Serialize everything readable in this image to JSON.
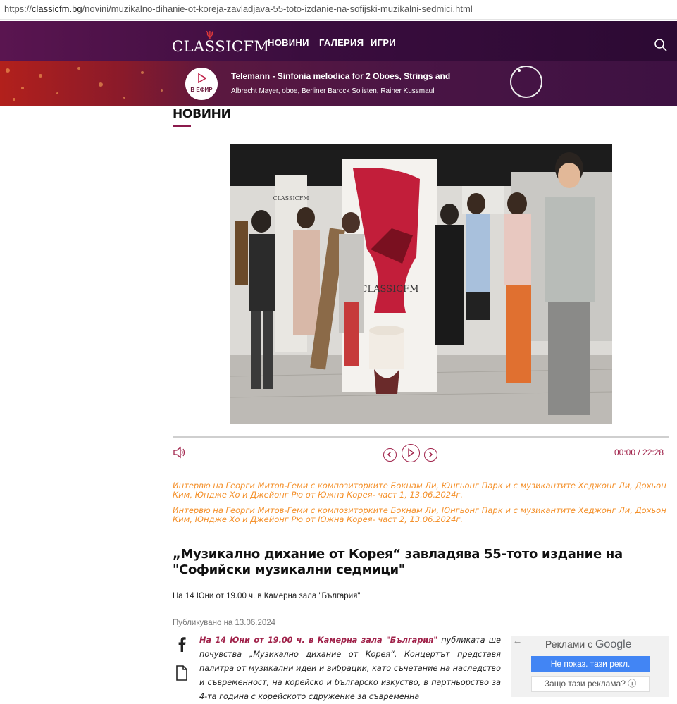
{
  "browser": {
    "url_scheme": "https://",
    "url_host": "classicfm.bg",
    "url_path": "/novini/muzikalno-dihanie-ot-koreja-zavladjava-55-toto-izdanie-na-sofijski-muzikalni-sedmici.html"
  },
  "header": {
    "logo_text": "CLASSIC",
    "logo_text_2": "FM",
    "nav": [
      "НОВИНИ",
      "ГАЛЕРИЯ",
      "ИГРИ"
    ]
  },
  "now_playing": {
    "onair_label": "В ЕФИР",
    "title": "Telemann - Sinfonia melodica for 2 Oboes, Strings and",
    "artists": "Albrecht Mayer, oboe, Berliner Barock Solisten, Rainer Kussmaul"
  },
  "section": {
    "title": "НОВИНИ"
  },
  "player": {
    "time": "00:00 / 22:28"
  },
  "podcasts": [
    "Интервю на Георги Митов-Геми с композиторките Бокнам Ли, Юнгьонг Парк и с музикантите Хеджонг Ли, Дохьон Ким, Юндже Хо и Джейонг Рю от Южна Корея- част 1, 13.06.2024г.",
    "Интервю на Георги Митов-Геми с композиторките Бокнам Ли, Юнгьонг Парк и с музикантите Хеджонг Ли, Дохьон Ким, Юндже Хо и Джейонг Рю от Южна Корея- част 2, 13.06.2024г."
  ],
  "article": {
    "title": "„Музикално дихание от Корея“ завладява 55-тото издание на \"Софийски музикални седмици\"",
    "subtitle": "На 14 Юни от 19.00 ч. в Камерна зала \"България\"",
    "published": "Публикувано на 13.06.2024",
    "lead": "На 14 Юни от 19.00 ч. в Камерна зала \"България\"",
    "body": " публиката ще почувства „Музикално дихание от Корея“. Концертът представя палитра от музикални идеи и вибрации, като съчетание на наследство и съвременност, на корейско и българско изкуство, в партньорство за 4-та година с корейското сдружение за съвременна"
  },
  "ad": {
    "back": "←",
    "heading_prefix": "Реклами с",
    "heading_brand": "Google",
    "stop_button": "Не показ. тази рекл.",
    "why_button": "Защо тази реклама? ⓘ"
  },
  "icons": {
    "search": "search-icon",
    "play": "play-icon",
    "volume": "volume-icon",
    "facebook": "facebook-icon",
    "document": "document-icon"
  },
  "colors": {
    "brand_purple": "#3a0d3e",
    "accent_red": "#a0224a",
    "podcast_orange": "#f4902a",
    "google_blue": "#4285f4"
  }
}
